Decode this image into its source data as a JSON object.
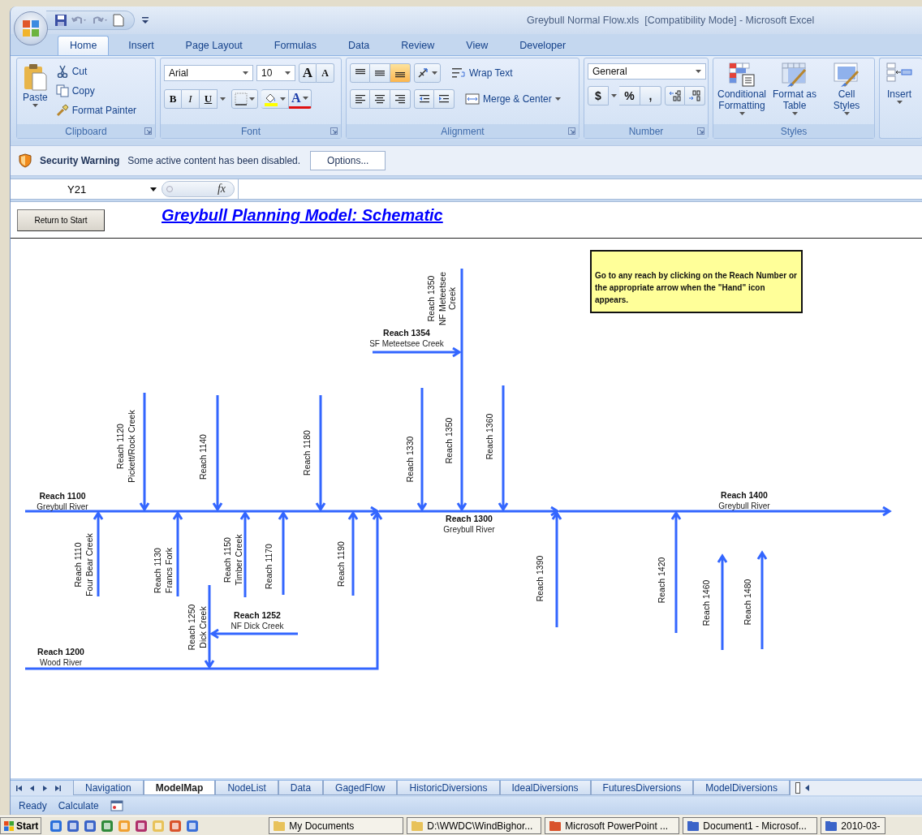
{
  "window": {
    "title": "Greybull Normal Flow.xls  [Compatibility Mode] - Microsoft Excel"
  },
  "ribbon_tabs": [
    {
      "label": "Home",
      "selected": true
    },
    {
      "label": "Insert",
      "selected": false
    },
    {
      "label": "Page Layout",
      "selected": false
    },
    {
      "label": "Formulas",
      "selected": false
    },
    {
      "label": "Data",
      "selected": false
    },
    {
      "label": "Review",
      "selected": false
    },
    {
      "label": "View",
      "selected": false
    },
    {
      "label": "Developer",
      "selected": false
    }
  ],
  "ribbon": {
    "clipboard": {
      "label": "Clipboard",
      "paste": "Paste",
      "cut": "Cut",
      "copy": "Copy",
      "format_painter": "Format Painter"
    },
    "font": {
      "label": "Font",
      "font_name": "Arial",
      "font_size": "10",
      "grow_font": "A",
      "shrink_font": "A",
      "bold": "B",
      "italic": "I",
      "underline": "U",
      "font_color": "A"
    },
    "alignment": {
      "label": "Alignment",
      "vertical_align": [
        {
          "selected": false
        },
        {
          "selected": false
        },
        {
          "selected": true
        }
      ],
      "horizontal_align": [
        {
          "selected": false
        },
        {
          "selected": false
        },
        {
          "selected": false
        }
      ],
      "wrap_text": "Wrap Text",
      "merge_center": "Merge & Center"
    },
    "number": {
      "label": "Number",
      "format": "General",
      "currency": "$",
      "percent": "%",
      "comma": ","
    },
    "styles": {
      "label": "Styles",
      "buttons": [
        "Conditional Formatting",
        "Format as Table",
        "Cell Styles"
      ]
    },
    "cells": {
      "insert": "Insert"
    }
  },
  "security_bar": {
    "title": "Security Warning",
    "message": "Some active content has been disabled.",
    "button": "Options..."
  },
  "formula_bar": {
    "name_box": "Y21",
    "fx": "fx"
  },
  "sheet": {
    "button": "Return to Start",
    "title": "Greybull Planning Model: Schematic",
    "note": "Go to any reach by clicking on the Reach Number  or the appropriate arrow when the \"Hand\" icon appears.",
    "reaches": [
      {
        "name": "Reach 1100",
        "river": "Greybull River"
      },
      {
        "name": "Reach 1110",
        "river": "Four Bear Creek"
      },
      {
        "name": "Reach 1120",
        "river": "Pickett/Rock Creek"
      },
      {
        "name": "Reach 1130",
        "river": "Francs Fork"
      },
      {
        "name": "Reach 1140"
      },
      {
        "name": "Reach 1150",
        "river": "Timber Creek"
      },
      {
        "name": "Reach 1170"
      },
      {
        "name": "Reach 1180"
      },
      {
        "name": "Reach 1190"
      },
      {
        "name": "Reach 1200",
        "river": "Wood River"
      },
      {
        "name": "Reach 1250",
        "river": "Dick Creek"
      },
      {
        "name": "Reach 1252",
        "river": "NF Dick Creek"
      },
      {
        "name": "Reach 1300",
        "river": "Greybull River"
      },
      {
        "name": "Reach 1330"
      },
      {
        "name": "Reach 1350",
        "river": "NF Meteetsee Creek"
      },
      {
        "name": "Reach 1350"
      },
      {
        "name": "Reach 1354",
        "river": "SF Meteetsee Creek"
      },
      {
        "name": "Reach 1360"
      },
      {
        "name": "Reach 1390"
      },
      {
        "name": "Reach 1400",
        "river": "Greybull River"
      },
      {
        "name": "Reach 1420"
      },
      {
        "name": "Reach 1460"
      },
      {
        "name": "Reach 1480"
      }
    ]
  },
  "sheet_tabs": [
    {
      "label": "Navigation",
      "selected": false
    },
    {
      "label": "ModelMap",
      "selected": true
    },
    {
      "label": "NodeList",
      "selected": false
    },
    {
      "label": "Data",
      "selected": false
    },
    {
      "label": "GagedFlow",
      "selected": false
    },
    {
      "label": "HistoricDiversions",
      "selected": false
    },
    {
      "label": "IdealDiversions",
      "selected": false
    },
    {
      "label": "FuturesDiversions",
      "selected": false
    },
    {
      "label": "ModelDiversions",
      "selected": false
    }
  ],
  "status_bar": {
    "ready": "Ready",
    "calculate": "Calculate"
  },
  "taskbar": {
    "start": "Start",
    "tasks": [
      {
        "label": "My Documents",
        "kind": "folder"
      },
      {
        "label": "D:\\WWDC\\WindBighor...",
        "kind": "folder"
      },
      {
        "label": "Microsoft PowerPoint ...",
        "kind": "presentation"
      },
      {
        "label": "Document1 - Microsof...",
        "kind": "document"
      },
      {
        "label": "2010-03-",
        "kind": "document"
      }
    ]
  }
}
